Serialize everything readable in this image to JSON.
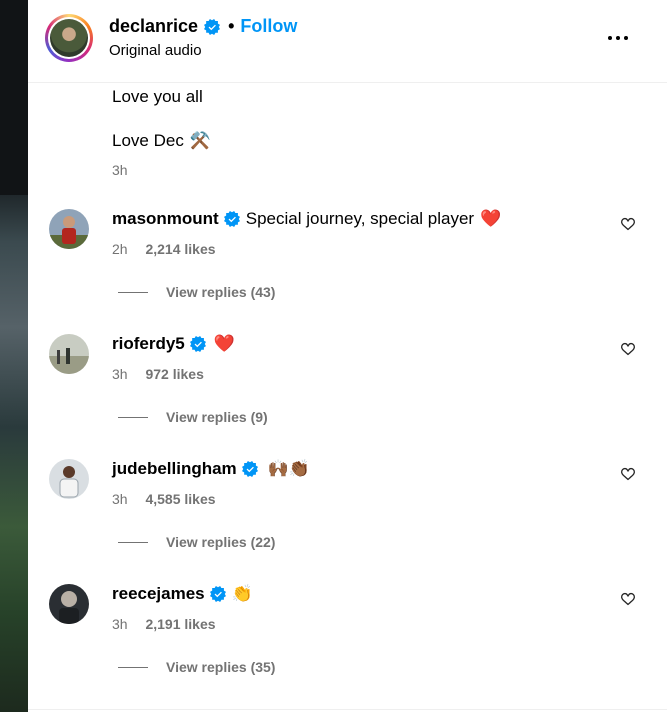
{
  "header": {
    "username": "declanrice",
    "follow_label": "Follow",
    "separator": "•",
    "audio": "Original audio"
  },
  "caption": {
    "line1": "Love you all",
    "line2": "Love Dec",
    "line2_emoji": "⚒️",
    "time": "3h"
  },
  "comments": [
    {
      "username": "masonmount",
      "text": "Special journey, special player",
      "emoji": "❤️",
      "time": "2h",
      "likes": "2,214 likes",
      "replies": "View replies (43)",
      "avatar_color": "#b3261e"
    },
    {
      "username": "rioferdy5",
      "text": "",
      "emoji": "❤️",
      "time": "3h",
      "likes": "972 likes",
      "replies": "View replies (9)",
      "avatar_color": "#8c8f7a"
    },
    {
      "username": "judebellingham",
      "text": "",
      "emoji": "🙌🏾👏🏾",
      "time": "3h",
      "likes": "4,585 likes",
      "replies": "View replies (22)",
      "avatar_color": "#7e8c96"
    },
    {
      "username": "reecejames",
      "text": "",
      "emoji": "👏",
      "time": "3h",
      "likes": "2,191 likes",
      "replies": "View replies (35)",
      "avatar_color": "#3a3f45"
    }
  ],
  "colors": {
    "accent": "#0095f6",
    "verified": "#0095f6",
    "meta_text": "#737373",
    "heart": "#ed1c3b"
  }
}
